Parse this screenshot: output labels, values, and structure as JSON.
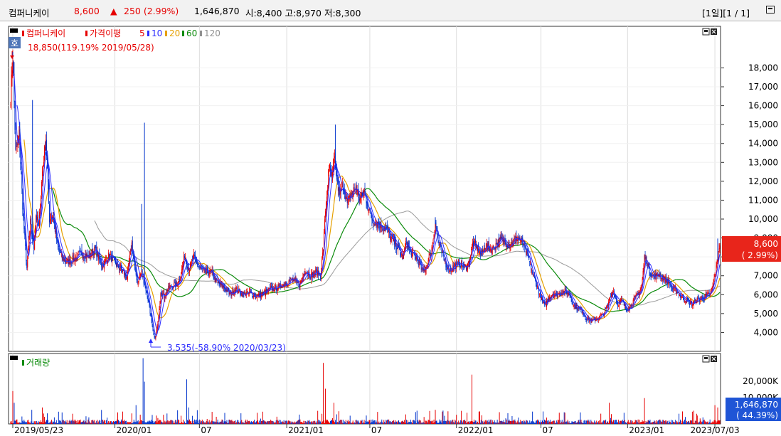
{
  "header": {
    "name": "컴퍼니케이",
    "price": "8,600",
    "change_arrow": "▲",
    "change": "250 (2.99%)",
    "volume": "1,646,870",
    "ohl": "시:8,400 고:8,970 저:8,300",
    "period": "[1일][1 / 1]",
    "window_icon": "window-restore-icon"
  },
  "price_panel": {
    "legend_name": "컴퍼니케이",
    "legend_ma_title": "가격이평",
    "ma_periods": [
      "5",
      "10",
      "20",
      "60",
      "120"
    ],
    "badge": "호",
    "max_label": "18,850(119.19% 2019/05/28)",
    "min_label": "3,535(-58.90% 2020/03/23)",
    "current_price": "8,600",
    "current_change": "( 2.99%)"
  },
  "volume_panel": {
    "legend": "거래량",
    "current_volume": "1,646,870",
    "current_ratio": "( 44.39%)"
  },
  "colors": {
    "up": "#e60000",
    "down": "#0033cc",
    "ma5": "#2d2dff",
    "ma10": "#e6a000",
    "ma20": "#0a8a0a",
    "ma60": "#909090",
    "ma120": "#909090",
    "price_box": "#e8251b",
    "volume_box": "#1f55d6"
  },
  "chart_data": {
    "type": "candlestick",
    "x_ticks": [
      "2019/05/23",
      "2020/01",
      "07",
      "2021/01",
      "07",
      "2022/01",
      "07",
      "2023/01",
      "2023/07/03"
    ],
    "y_ticks": [
      "18,000",
      "17,000",
      "16,000",
      "15,000",
      "14,000",
      "13,000",
      "12,000",
      "11,000",
      "10,000",
      "9,000",
      "8,000",
      "7,000",
      "6,000",
      "5,000",
      "4,000"
    ],
    "ylim": [
      3000,
      20200
    ],
    "volume_ticks": [
      "20,000K",
      "10,000K"
    ],
    "volume_ylim": [
      0,
      30000
    ],
    "price_path": [
      [
        0,
        16500
      ],
      [
        3,
        18850
      ],
      [
        7,
        13500
      ],
      [
        12,
        14500
      ],
      [
        18,
        10000
      ],
      [
        23,
        7400
      ],
      [
        28,
        9800
      ],
      [
        33,
        8500
      ],
      [
        36,
        10200
      ],
      [
        40,
        9600
      ],
      [
        45,
        12500
      ],
      [
        50,
        14300
      ],
      [
        55,
        10000
      ],
      [
        60,
        10200
      ],
      [
        66,
        8700
      ],
      [
        72,
        8000
      ],
      [
        80,
        7700
      ],
      [
        90,
        7900
      ],
      [
        100,
        8200
      ],
      [
        110,
        8000
      ],
      [
        120,
        8400
      ],
      [
        130,
        7500
      ],
      [
        140,
        8100
      ],
      [
        150,
        7600
      ],
      [
        160,
        7200
      ],
      [
        165,
        6900
      ],
      [
        172,
        8700
      ],
      [
        176,
        7400
      ],
      [
        180,
        6700
      ],
      [
        186,
        7200
      ],
      [
        192,
        6300
      ],
      [
        197,
        5400
      ],
      [
        202,
        4000
      ],
      [
        205,
        3535
      ],
      [
        209,
        4500
      ],
      [
        213,
        6200
      ],
      [
        218,
        5900
      ],
      [
        224,
        6300
      ],
      [
        230,
        6500
      ],
      [
        236,
        6500
      ],
      [
        241,
        6900
      ],
      [
        247,
        8100
      ],
      [
        253,
        7300
      ],
      [
        260,
        8000
      ],
      [
        268,
        7400
      ],
      [
        276,
        7200
      ],
      [
        285,
        7200
      ],
      [
        292,
        6700
      ],
      [
        300,
        6500
      ],
      [
        305,
        6300
      ],
      [
        312,
        6000
      ],
      [
        320,
        6300
      ],
      [
        330,
        6000
      ],
      [
        340,
        6100
      ],
      [
        350,
        5900
      ],
      [
        360,
        6100
      ],
      [
        370,
        6300
      ],
      [
        380,
        6400
      ],
      [
        390,
        6600
      ],
      [
        400,
        6800
      ],
      [
        410,
        6500
      ],
      [
        418,
        7300
      ],
      [
        426,
        7000
      ],
      [
        434,
        7200
      ],
      [
        440,
        7000
      ],
      [
        444,
        8500
      ],
      [
        447,
        10500
      ],
      [
        450,
        11700
      ],
      [
        453,
        12800
      ],
      [
        456,
        12000
      ],
      [
        460,
        13200
      ],
      [
        463,
        12200
      ],
      [
        467,
        11200
      ],
      [
        472,
        11800
      ],
      [
        478,
        10800
      ],
      [
        483,
        11300
      ],
      [
        490,
        11700
      ],
      [
        496,
        11000
      ],
      [
        502,
        11500
      ],
      [
        507,
        10700
      ],
      [
        513,
        10000
      ],
      [
        520,
        9800
      ],
      [
        528,
        9600
      ],
      [
        535,
        9400
      ],
      [
        540,
        9000
      ],
      [
        546,
        8700
      ],
      [
        552,
        8300
      ],
      [
        557,
        8000
      ],
      [
        562,
        8800
      ],
      [
        568,
        8200
      ],
      [
        575,
        8000
      ],
      [
        580,
        7700
      ],
      [
        585,
        7200
      ],
      [
        590,
        7500
      ],
      [
        597,
        8200
      ],
      [
        603,
        9800
      ],
      [
        607,
        8900
      ],
      [
        612,
        8200
      ],
      [
        617,
        7700
      ],
      [
        622,
        7300
      ],
      [
        630,
        7500
      ],
      [
        637,
        7700
      ],
      [
        645,
        7400
      ],
      [
        651,
        7700
      ],
      [
        656,
        8700
      ],
      [
        662,
        8500
      ],
      [
        668,
        8100
      ],
      [
        675,
        8600
      ],
      [
        682,
        8400
      ],
      [
        690,
        8700
      ],
      [
        696,
        8900
      ],
      [
        702,
        8800
      ],
      [
        708,
        8600
      ],
      [
        715,
        8900
      ],
      [
        720,
        9000
      ],
      [
        726,
        8800
      ],
      [
        732,
        8200
      ],
      [
        737,
        7700
      ],
      [
        742,
        7000
      ],
      [
        747,
        6500
      ],
      [
        752,
        5900
      ],
      [
        758,
        5400
      ],
      [
        764,
        5800
      ],
      [
        770,
        6100
      ],
      [
        776,
        6000
      ],
      [
        782,
        6100
      ],
      [
        788,
        6200
      ],
      [
        794,
        6000
      ],
      [
        800,
        5400
      ],
      [
        806,
        5300
      ],
      [
        812,
        5100
      ],
      [
        818,
        4700
      ],
      [
        824,
        4600
      ],
      [
        830,
        4700
      ],
      [
        836,
        4800
      ],
      [
        842,
        5000
      ],
      [
        848,
        5400
      ],
      [
        852,
        6000
      ],
      [
        856,
        6200
      ],
      [
        862,
        5500
      ],
      [
        868,
        5700
      ],
      [
        874,
        5200
      ],
      [
        880,
        5400
      ],
      [
        886,
        5800
      ],
      [
        892,
        6100
      ],
      [
        896,
        6400
      ],
      [
        900,
        8000
      ],
      [
        904,
        7700
      ],
      [
        908,
        7200
      ],
      [
        913,
        6900
      ],
      [
        920,
        7100
      ],
      [
        928,
        6800
      ],
      [
        934,
        6700
      ],
      [
        940,
        6300
      ],
      [
        946,
        6200
      ],
      [
        950,
        6000
      ],
      [
        956,
        5800
      ],
      [
        962,
        5600
      ],
      [
        968,
        5500
      ],
      [
        974,
        5700
      ],
      [
        980,
        5800
      ],
      [
        986,
        5900
      ],
      [
        992,
        6000
      ],
      [
        996,
        6300
      ],
      [
        1000,
        7000
      ],
      [
        1003,
        7600
      ],
      [
        1006,
        8600
      ]
    ]
  }
}
